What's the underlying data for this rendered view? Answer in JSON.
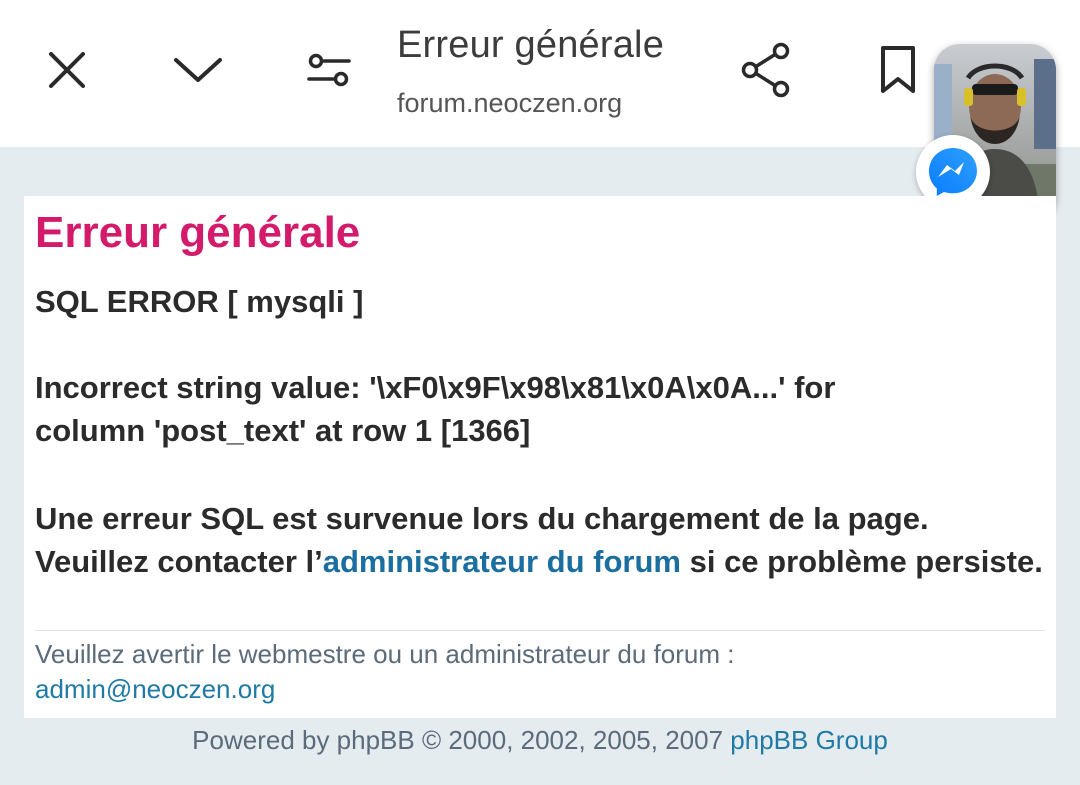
{
  "toolbar": {
    "close_icon": "close-icon",
    "collapse_icon": "chevron-down-icon",
    "settings_icon": "tune-icon",
    "share_icon": "share-icon",
    "bookmark_icon": "bookmark-icon"
  },
  "header": {
    "title": "Erreur générale",
    "domain": "forum.neoczen.org"
  },
  "chat_head": {
    "badge_icon": "messenger-icon"
  },
  "error": {
    "title": "Erreur générale",
    "sql_line": "SQL ERROR [ mysqli ]",
    "detail_line1": "Incorrect string value: '\\xF0\\x9F\\x98\\x81\\x0A\\x0A...' for",
    "detail_line2": "column 'post_text' at row 1 [1366]",
    "msg_part1": "Une erreur SQL est survenue lors du chargement de la page. Veuillez contacter l’",
    "msg_link": "administrateur du forum",
    "msg_part2": " si ce problème persiste."
  },
  "footer": {
    "note": "Veuillez avertir le webmestre ou un administrateur du forum :",
    "email": "admin@neoczen.org",
    "powered_prefix": "Powered by phpBB © 2000, 2002, 2005, 2007 ",
    "powered_link": "phpBB Group"
  },
  "colors": {
    "title_accent": "#d31a6b",
    "link": "#1a6ea0",
    "background": "#e5ecf0"
  }
}
